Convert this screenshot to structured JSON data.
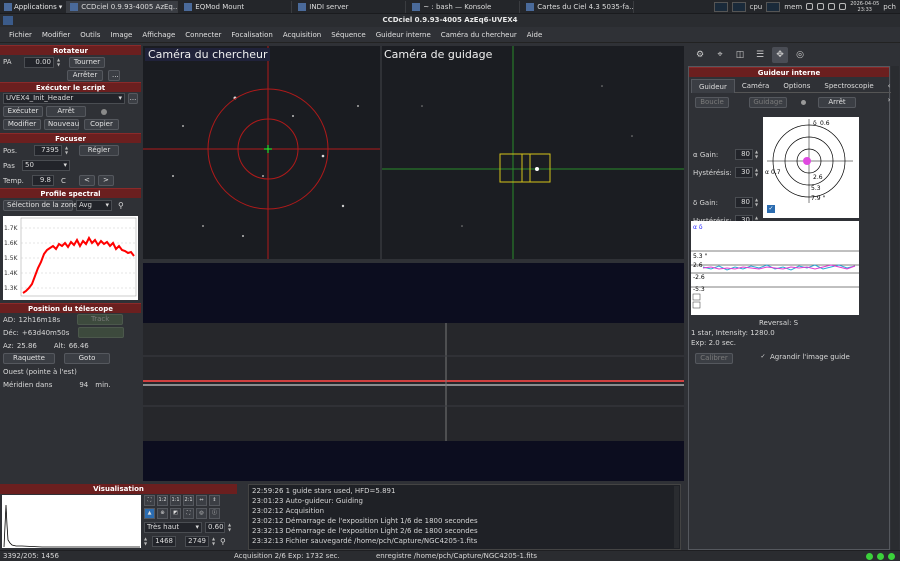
{
  "taskbar": {
    "app_menu": "Applications",
    "tasks": [
      "CCDciel 0.9.93-4005 AzEq...",
      "EQMod Mount",
      "INDI server",
      "~ : bash — Konsole",
      "Cartes du Ciel 4.3 5035-fa..."
    ],
    "tray": {
      "cpu": "cpu",
      "mem": "mem",
      "date": "2026-04-05",
      "time": "23:33",
      "user": "pch"
    }
  },
  "window": {
    "title": "CCDciel 0.9.93-4005 AzEq6-UVEX4"
  },
  "menu": [
    "Fichier",
    "Modifier",
    "Outils",
    "Image",
    "Affichage",
    "Connecter",
    "Focalisation",
    "Acquisition",
    "Séquence",
    "Guideur interne",
    "Caméra du chercheur",
    "Aide"
  ],
  "rotator": {
    "header": "Rotateur",
    "pa_label": "PA",
    "pa_value": "0.00",
    "rotate": "Tourner",
    "stop": "Arrêter",
    "more": "..."
  },
  "script": {
    "header": "Exécuter le script",
    "selected": "UVEX4_Init_Header",
    "more": "...",
    "run": "Exécuter",
    "stop": "Arrêt",
    "edit": "Modifier",
    "new": "Nouveau",
    "copy": "Copier"
  },
  "focuser": {
    "header": "Focuser",
    "pos_label": "Pos.",
    "pos_value": "7395",
    "set": "Régler",
    "step_label": "Pas",
    "step_value": "50",
    "temp_label": "Temp.",
    "temp_value": "9.8",
    "temp_unit": "C",
    "left": "<",
    "right": ">"
  },
  "spectral": {
    "header": "Profile spectral",
    "zone_btn": "Sélection de la zone",
    "mode": "Avg",
    "y_ticks": [
      "1.7K",
      "1.6K",
      "1.5K",
      "1.4K",
      "1.3K"
    ]
  },
  "telescope": {
    "header": "Position du télescope",
    "ra_label": "AD:",
    "ra_value": "12h16m18s",
    "track_btn": "Track",
    "dec_label": "Déc:",
    "dec_value": "+63d40m50s",
    "slew_btn": "",
    "az_label": "Az:",
    "az_value": "25.86",
    "alt_label": "Alt:",
    "alt_value": "66.46",
    "park": "Raquette",
    "goto": "Goto",
    "pier": "Ouest (pointe à l'est)",
    "meridian_label": "Méridien dans",
    "meridian_value": "94",
    "meridian_unit": "min."
  },
  "views": {
    "finder": "Caméra du chercheur",
    "guide": "Caméra de guidage"
  },
  "visualisation": {
    "header": "Visualisation",
    "z1": "1:2",
    "z2": "1:1",
    "z3": "2:1",
    "stretch": "Très haut",
    "gamma": "0.60",
    "min": "1468",
    "max": "2749"
  },
  "log": [
    "22:59:26 1 guide stars used, HFD=5.891",
    "23:01:23 Auto-guideur: Guiding",
    "23:02:12 Acquisition",
    "23:02:12 Démarrage de l'exposition Light 1/6 de 1800 secondes",
    "23:32:13 Démarrage de l'exposition Light 2/6 de 1800 secondes",
    "23:32:13 Fichier sauvegardé /home/pch/Capture/NGC4205-1.fits"
  ],
  "status": {
    "coords": "3392/205: 1456",
    "acq": "Acquisition 2/6 Exp: 1732 sec.",
    "file": "enregistre /home/pch/Capture/NGC4205-1.fits"
  },
  "guider": {
    "header": "Guideur interne",
    "tabs": [
      "Guideur",
      "Caméra",
      "Options",
      "Spectroscopie"
    ],
    "loop": "Boucle",
    "guide": "Guidage",
    "stop": "Arrêt",
    "ra_gain_label": "α Gain:",
    "ra_gain": "80",
    "ra_hyst_label": "Hystérésis:",
    "ra_hyst": "30",
    "dec_gain_label": "δ Gain:",
    "dec_gain": "80",
    "dec_hyst_label": "Hystérésis:",
    "dec_hyst": "30",
    "target_labels": {
      "delta": "δ",
      "delta_val": "0.6",
      "alpha": "α",
      "alpha_val": "0.7",
      "r1": "2.6",
      "r2": "5.3",
      "r3": "7.9 \""
    },
    "graph_legend": "α δ",
    "graph_labels": [
      "5.3 \"",
      "2.6",
      "-2.6",
      "-5.3"
    ],
    "reversal": "Reversal: S",
    "stars": "1 star, Intensity: 1280.0",
    "exp": "Exp: 2.0 sec.",
    "calibrate": "Calibrer",
    "enlarge": "Agrandir l'image guide"
  }
}
